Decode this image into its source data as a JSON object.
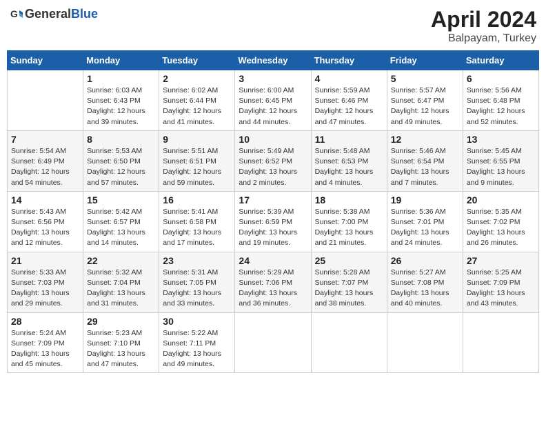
{
  "header": {
    "logo_general": "General",
    "logo_blue": "Blue",
    "title": "April 2024",
    "subtitle": "Balpayam, Turkey"
  },
  "days_of_week": [
    "Sunday",
    "Monday",
    "Tuesday",
    "Wednesday",
    "Thursday",
    "Friday",
    "Saturday"
  ],
  "weeks": [
    [
      {
        "day": "",
        "details": ""
      },
      {
        "day": "1",
        "details": "Sunrise: 6:03 AM\nSunset: 6:43 PM\nDaylight: 12 hours\nand 39 minutes."
      },
      {
        "day": "2",
        "details": "Sunrise: 6:02 AM\nSunset: 6:44 PM\nDaylight: 12 hours\nand 41 minutes."
      },
      {
        "day": "3",
        "details": "Sunrise: 6:00 AM\nSunset: 6:45 PM\nDaylight: 12 hours\nand 44 minutes."
      },
      {
        "day": "4",
        "details": "Sunrise: 5:59 AM\nSunset: 6:46 PM\nDaylight: 12 hours\nand 47 minutes."
      },
      {
        "day": "5",
        "details": "Sunrise: 5:57 AM\nSunset: 6:47 PM\nDaylight: 12 hours\nand 49 minutes."
      },
      {
        "day": "6",
        "details": "Sunrise: 5:56 AM\nSunset: 6:48 PM\nDaylight: 12 hours\nand 52 minutes."
      }
    ],
    [
      {
        "day": "7",
        "details": "Sunrise: 5:54 AM\nSunset: 6:49 PM\nDaylight: 12 hours\nand 54 minutes."
      },
      {
        "day": "8",
        "details": "Sunrise: 5:53 AM\nSunset: 6:50 PM\nDaylight: 12 hours\nand 57 minutes."
      },
      {
        "day": "9",
        "details": "Sunrise: 5:51 AM\nSunset: 6:51 PM\nDaylight: 12 hours\nand 59 minutes."
      },
      {
        "day": "10",
        "details": "Sunrise: 5:49 AM\nSunset: 6:52 PM\nDaylight: 13 hours\nand 2 minutes."
      },
      {
        "day": "11",
        "details": "Sunrise: 5:48 AM\nSunset: 6:53 PM\nDaylight: 13 hours\nand 4 minutes."
      },
      {
        "day": "12",
        "details": "Sunrise: 5:46 AM\nSunset: 6:54 PM\nDaylight: 13 hours\nand 7 minutes."
      },
      {
        "day": "13",
        "details": "Sunrise: 5:45 AM\nSunset: 6:55 PM\nDaylight: 13 hours\nand 9 minutes."
      }
    ],
    [
      {
        "day": "14",
        "details": "Sunrise: 5:43 AM\nSunset: 6:56 PM\nDaylight: 13 hours\nand 12 minutes."
      },
      {
        "day": "15",
        "details": "Sunrise: 5:42 AM\nSunset: 6:57 PM\nDaylight: 13 hours\nand 14 minutes."
      },
      {
        "day": "16",
        "details": "Sunrise: 5:41 AM\nSunset: 6:58 PM\nDaylight: 13 hours\nand 17 minutes."
      },
      {
        "day": "17",
        "details": "Sunrise: 5:39 AM\nSunset: 6:59 PM\nDaylight: 13 hours\nand 19 minutes."
      },
      {
        "day": "18",
        "details": "Sunrise: 5:38 AM\nSunset: 7:00 PM\nDaylight: 13 hours\nand 21 minutes."
      },
      {
        "day": "19",
        "details": "Sunrise: 5:36 AM\nSunset: 7:01 PM\nDaylight: 13 hours\nand 24 minutes."
      },
      {
        "day": "20",
        "details": "Sunrise: 5:35 AM\nSunset: 7:02 PM\nDaylight: 13 hours\nand 26 minutes."
      }
    ],
    [
      {
        "day": "21",
        "details": "Sunrise: 5:33 AM\nSunset: 7:03 PM\nDaylight: 13 hours\nand 29 minutes."
      },
      {
        "day": "22",
        "details": "Sunrise: 5:32 AM\nSunset: 7:04 PM\nDaylight: 13 hours\nand 31 minutes."
      },
      {
        "day": "23",
        "details": "Sunrise: 5:31 AM\nSunset: 7:05 PM\nDaylight: 13 hours\nand 33 minutes."
      },
      {
        "day": "24",
        "details": "Sunrise: 5:29 AM\nSunset: 7:06 PM\nDaylight: 13 hours\nand 36 minutes."
      },
      {
        "day": "25",
        "details": "Sunrise: 5:28 AM\nSunset: 7:07 PM\nDaylight: 13 hours\nand 38 minutes."
      },
      {
        "day": "26",
        "details": "Sunrise: 5:27 AM\nSunset: 7:08 PM\nDaylight: 13 hours\nand 40 minutes."
      },
      {
        "day": "27",
        "details": "Sunrise: 5:25 AM\nSunset: 7:09 PM\nDaylight: 13 hours\nand 43 minutes."
      }
    ],
    [
      {
        "day": "28",
        "details": "Sunrise: 5:24 AM\nSunset: 7:09 PM\nDaylight: 13 hours\nand 45 minutes."
      },
      {
        "day": "29",
        "details": "Sunrise: 5:23 AM\nSunset: 7:10 PM\nDaylight: 13 hours\nand 47 minutes."
      },
      {
        "day": "30",
        "details": "Sunrise: 5:22 AM\nSunset: 7:11 PM\nDaylight: 13 hours\nand 49 minutes."
      },
      {
        "day": "",
        "details": ""
      },
      {
        "day": "",
        "details": ""
      },
      {
        "day": "",
        "details": ""
      },
      {
        "day": "",
        "details": ""
      }
    ]
  ]
}
